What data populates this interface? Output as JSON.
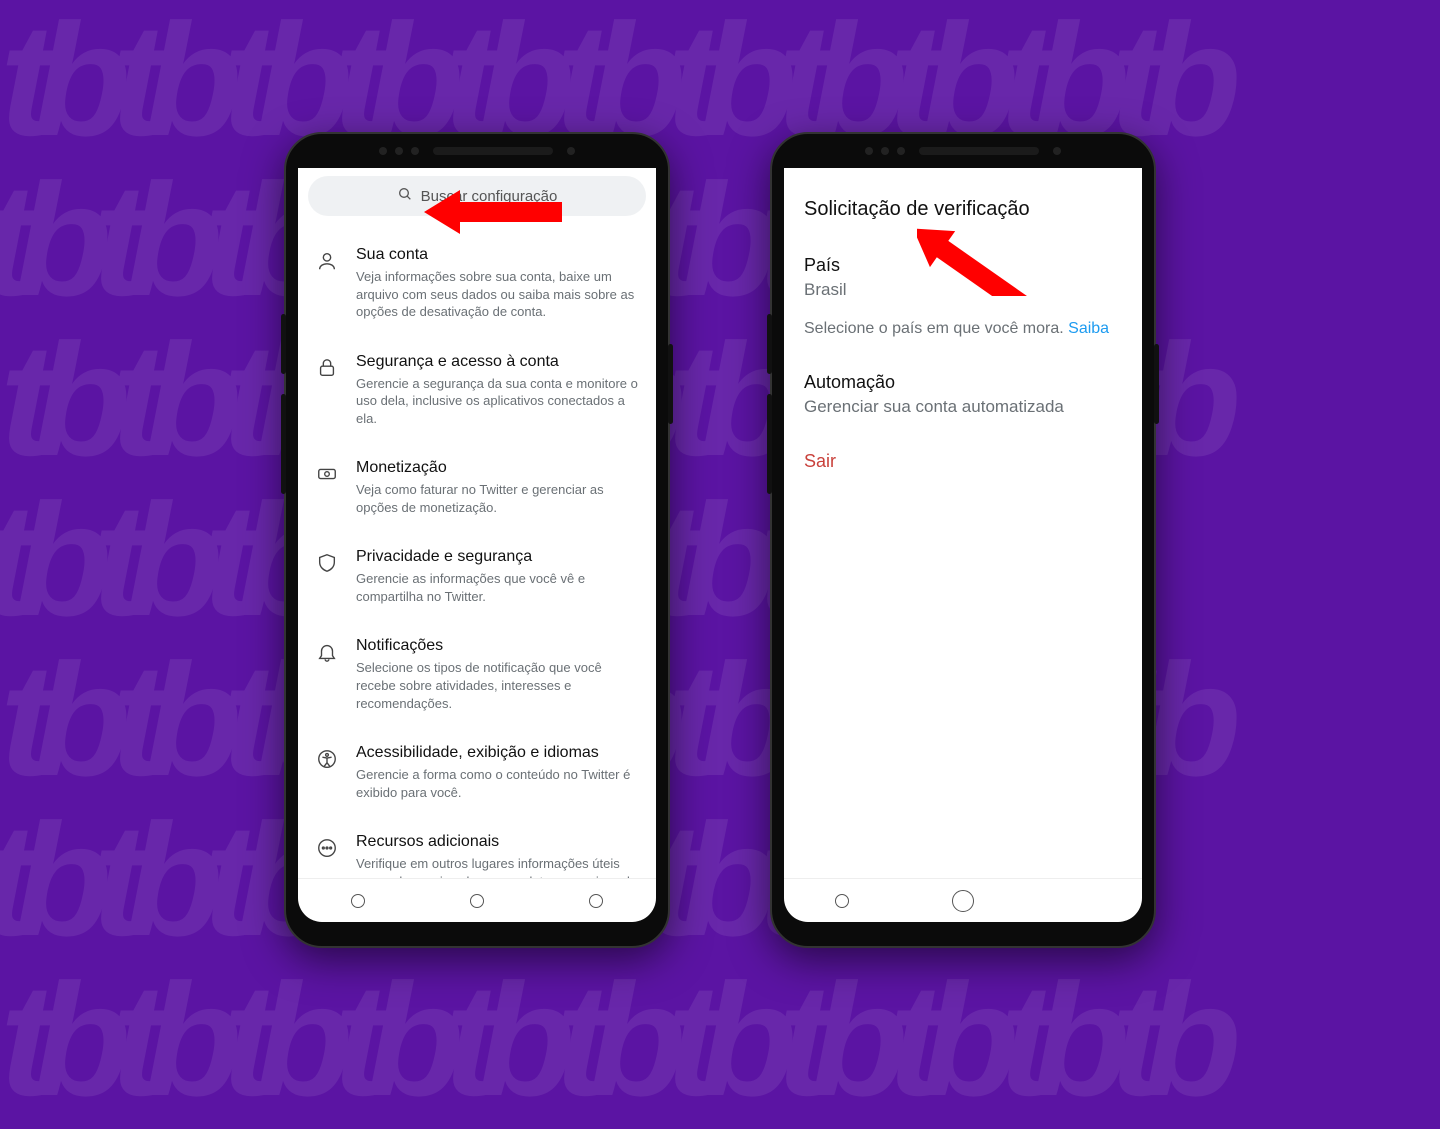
{
  "pattern_text": "tbtbtbtbtbtbtbtbtbtbtb",
  "left": {
    "search_placeholder": "Buscar configuração",
    "items": [
      {
        "title": "Sua conta",
        "desc": "Veja informações sobre sua conta, baixe um arquivo com seus dados ou saiba mais sobre as opções de desativação de conta."
      },
      {
        "title": "Segurança e acesso à conta",
        "desc": "Gerencie a segurança da sua conta e monitore o uso dela, inclusive os aplicativos conectados a ela."
      },
      {
        "title": "Monetização",
        "desc": "Veja como faturar no Twitter e gerenciar as opções de monetização."
      },
      {
        "title": "Privacidade e segurança",
        "desc": "Gerencie as informações que você vê e compartilha no Twitter."
      },
      {
        "title": "Notificações",
        "desc": "Selecione os tipos de notificação que você recebe sobre atividades, interesses e recomendações."
      },
      {
        "title": "Acessibilidade, exibição e idiomas",
        "desc": "Gerencie a forma como o conteúdo no Twitter é exibido para você."
      },
      {
        "title": "Recursos adicionais",
        "desc": "Verifique em outros lugares informações úteis para saber mais sobre os produtos e serviços do Twitter."
      }
    ]
  },
  "right": {
    "header": "Solicitação de verificação",
    "country_label": "País",
    "country_value": "Brasil",
    "hint_text": "Selecione o país em que você mora. ",
    "hint_link": "Saiba",
    "automation_title": "Automação",
    "automation_desc": "Gerenciar sua conta automatizada",
    "logout": "Sair"
  }
}
